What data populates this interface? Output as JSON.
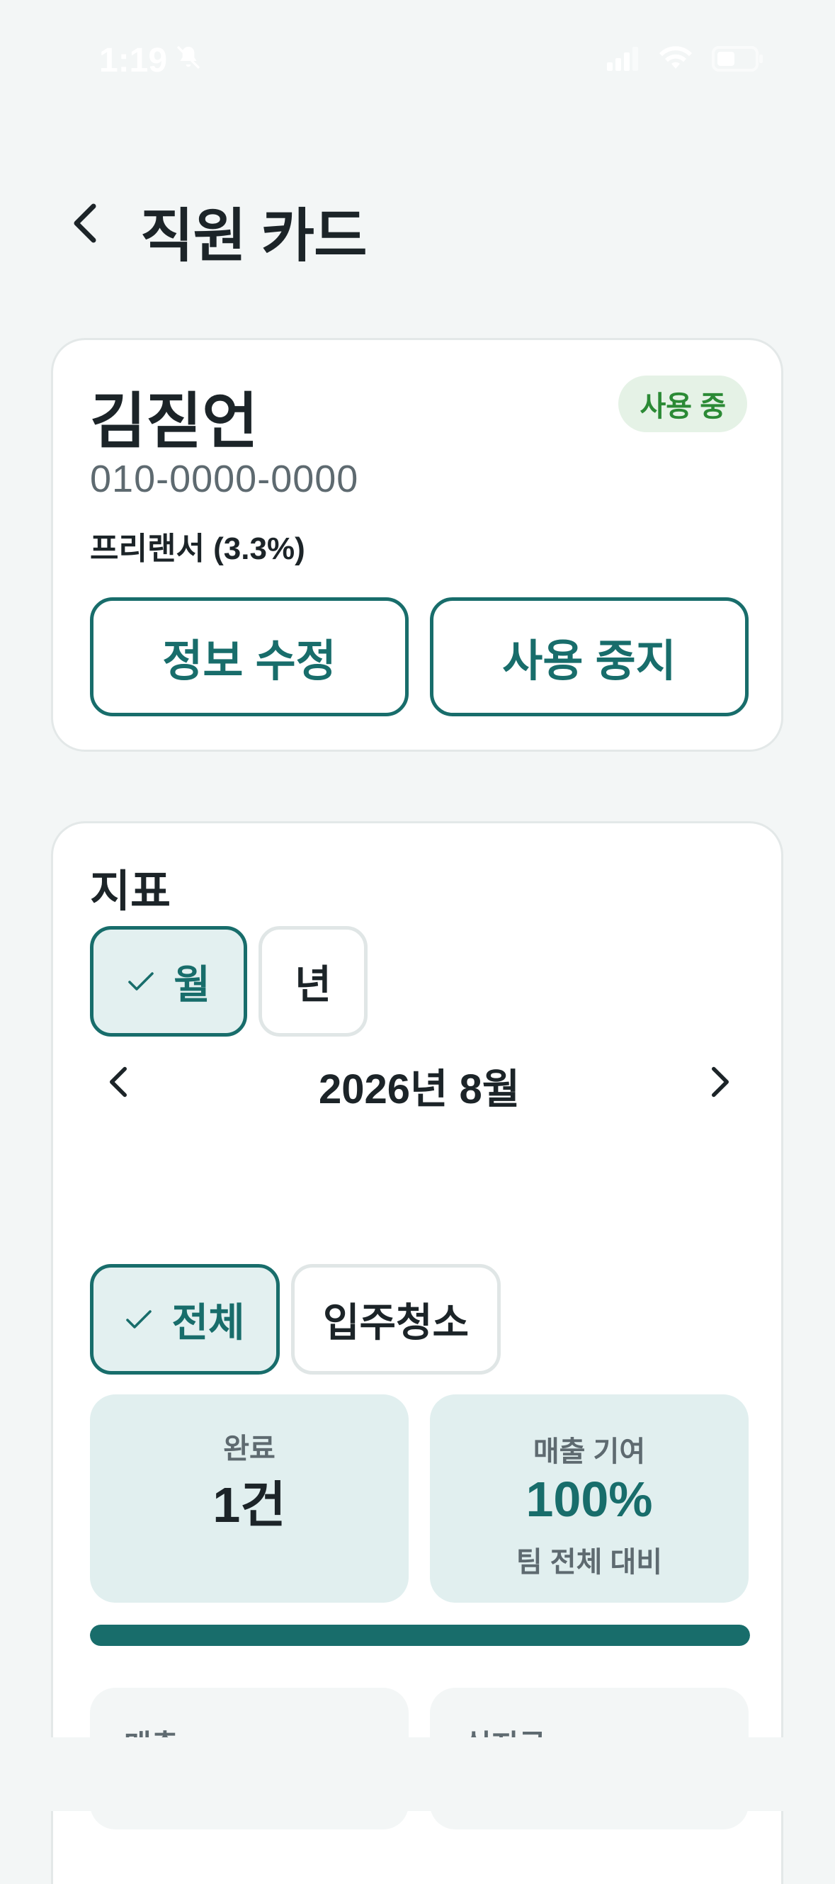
{
  "status_bar": {
    "time": "1:19",
    "icons": [
      "bell-slash-icon",
      "signal-icon",
      "wifi-icon",
      "battery-icon"
    ]
  },
  "header": {
    "title": "직원 카드"
  },
  "profile": {
    "name": "김짇언",
    "status": "사용 중",
    "phone": "010-0000-0000",
    "type": "프리랜서 (3.3%)",
    "edit_label": "정보 수정",
    "stop_label": "사용 중지"
  },
  "metrics": {
    "title": "지표",
    "period_tabs": [
      {
        "label": "월",
        "selected": true
      },
      {
        "label": "년",
        "selected": false
      }
    ],
    "period": "2026년 8월",
    "filter_tabs": [
      {
        "label": "전체",
        "selected": true
      },
      {
        "label": "입주청소",
        "selected": false
      }
    ],
    "done": {
      "label": "완료",
      "value": "1건"
    },
    "sales_share": {
      "label": "매출 기여",
      "value": "100%",
      "sub": "팀 전체 대비"
    },
    "progress_percent": 100,
    "mini_cards": [
      {
        "label": "매출"
      },
      {
        "label": "실지급"
      }
    ]
  },
  "colors": {
    "accent": "#186d6b",
    "accent_light": "#e3f0f0",
    "badge_bg": "#e5f2e6",
    "badge_text": "#2b8a35",
    "background": "#f3f6f6"
  }
}
